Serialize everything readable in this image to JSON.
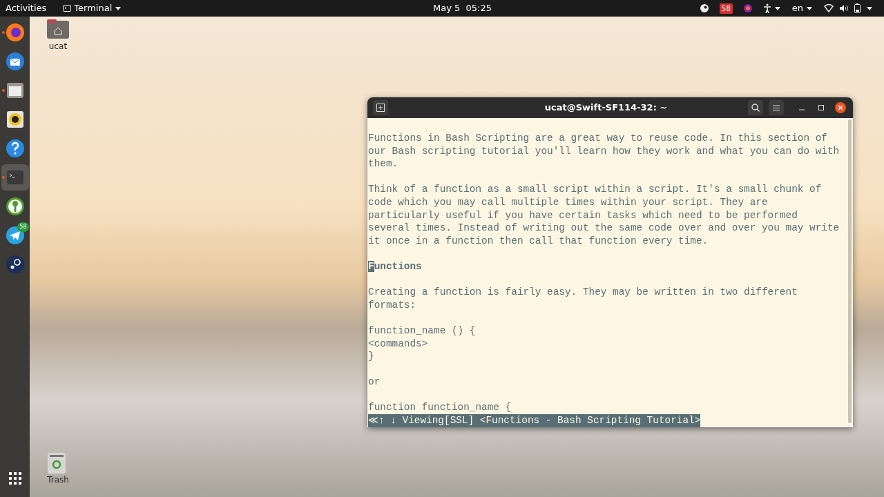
{
  "top_bar": {
    "activities": "Activities",
    "app_menu": "Terminal",
    "clock": "May 5  05:25",
    "tray_badge": "58",
    "language": "en"
  },
  "dock": {
    "items": [
      {
        "kind": "browser",
        "running": true,
        "selected": false
      },
      {
        "kind": "mail",
        "running": false,
        "selected": false
      },
      {
        "kind": "files",
        "running": true,
        "selected": false
      },
      {
        "kind": "music",
        "running": false,
        "selected": false
      },
      {
        "kind": "help",
        "running": false,
        "selected": false
      },
      {
        "kind": "terminal",
        "running": true,
        "selected": true
      },
      {
        "kind": "key",
        "running": false,
        "selected": false
      },
      {
        "kind": "messenger",
        "running": false,
        "selected": false,
        "badge": "58"
      },
      {
        "kind": "game",
        "running": false,
        "selected": false
      }
    ]
  },
  "desktop_icons": [
    {
      "kind": "home",
      "label": "ucat"
    },
    {
      "kind": "trash",
      "label": "Trash"
    }
  ],
  "terminal": {
    "title": "ucat@Swift-SF114-32: ~",
    "blocks": [
      {
        "kind": "text",
        "lines": [
          "Functions in Bash Scripting are a great way to reuse code. In this section of",
          "our Bash scripting tutorial you'll learn how they work and what you can do with",
          "them."
        ]
      },
      {
        "kind": "text",
        "lines": [
          "Think of a function as a small script within a script. It's a small chunk of",
          "code which you may call multiple times within your script. They are",
          "particularly useful if you have certain tasks which need to be performed",
          "several times. Instead of writing out the same code over and over you may write",
          "it once in a function then call that function every time."
        ]
      },
      {
        "kind": "heading",
        "cursor": true,
        "lines": [
          "Functions"
        ]
      },
      {
        "kind": "text",
        "lines": [
          "Creating a function is fairly easy. They may be written in two different",
          "formats:"
        ]
      },
      {
        "kind": "text",
        "lines": [
          "function_name () {",
          "<commands>",
          "}"
        ]
      },
      {
        "kind": "text",
        "lines": [
          "or"
        ]
      },
      {
        "kind": "text",
        "lines": [
          "function function_name {"
        ]
      }
    ],
    "status_line": "≪↑ ↓ Viewing[SSL] <Functions - Bash Scripting Tutorial>"
  }
}
